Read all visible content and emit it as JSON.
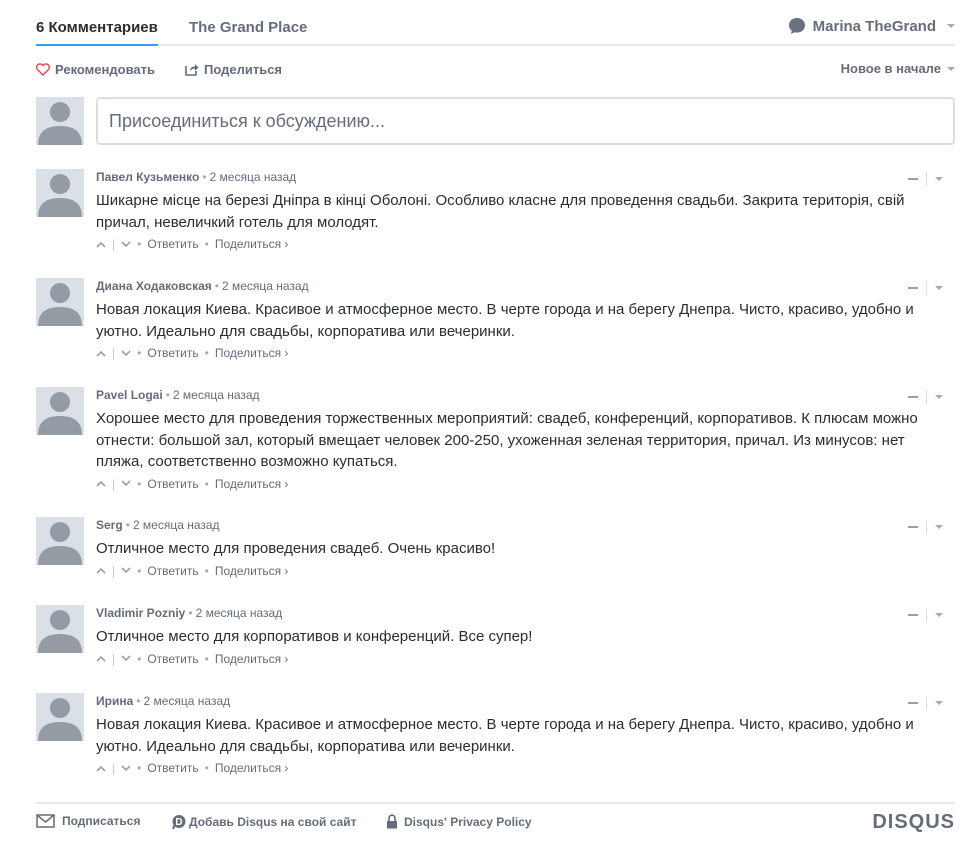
{
  "nav": {
    "comments_tab": "6 Комментариев",
    "site_tab": "The Grand Place",
    "user_name": "Marina TheGrand"
  },
  "actions": {
    "recommend": "Рекомендовать",
    "share": "Поделиться",
    "sort": "Новое в начале"
  },
  "composer": {
    "placeholder": "Присоединиться к обсуждению..."
  },
  "comment_labels": {
    "reply": "Ответить",
    "share": "Поделиться ›"
  },
  "comments": [
    {
      "author": "Павел Кузьменко",
      "time": "2 месяца назад",
      "text": "Шикарне місце на березі Дніпра в кінці Оболоні. Особливо класне для проведення свадьби. Закрита територія, свій причал, невеличкий готель для молодят."
    },
    {
      "author": "Диана Ходаковская",
      "time": "2 месяца назад",
      "text": "Новая локация Киева. Красивое и атмосферное место. В черте города и на берегу Днепра. Чисто, красиво, удобно и уютно. Идеально для свадьбы, корпоратива или вечеринки."
    },
    {
      "author": "Pavel Logai",
      "time": "2 месяца назад",
      "text": "Хорошее место для проведения торжественных мероприятий: свадеб, конференций, корпоративов. К плюсам можно отнести: большой зал, который вмещает человек 200-250, ухоженная зеленая территория, причал. Из минусов: нет пляжа, соответственно возможно купаться."
    },
    {
      "author": "Serg",
      "time": "2 месяца назад",
      "text": "Отличное место для проведения свадеб. Очень красиво!"
    },
    {
      "author": "Vladimir Pozniy",
      "time": "2 месяца назад",
      "text": "Отличное место для корпоративов и конференций. Все супер!"
    },
    {
      "author": "Ирина",
      "time": "2 месяца назад",
      "text": "Новая локация Киева. Красивое и атмосферное место. В черте города и на берегу Днепра. Чисто, красиво, удобно и уютно. Идеально для свадьбы, корпоратива или вечеринки."
    }
  ],
  "bottom": {
    "subscribe": "Подписаться",
    "add_disqus": "Добавь Disqus на свой сайт",
    "privacy": "Disqus' Privacy Policy",
    "logo": "DISQUS"
  },
  "colors": {
    "accent": "#2e9fff",
    "text": "#2a2e2e",
    "muted": "#656c7a",
    "avatar_bg": "#dbe0e6",
    "avatar_fg": "#959ba5",
    "heart": "#e0454f"
  }
}
